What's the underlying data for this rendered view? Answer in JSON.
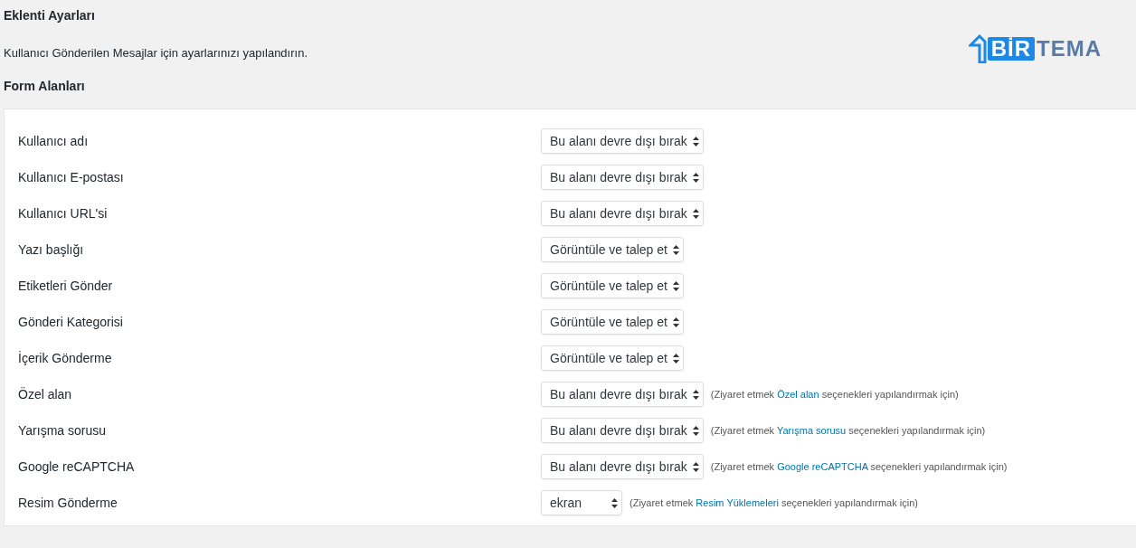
{
  "title": "Eklenti Ayarları",
  "description": "Kullanıcı Gönderilen Mesajlar için ayarlarınızı yapılandırın.",
  "logo": {
    "boxed": "BİR",
    "plain": "TEMA"
  },
  "section_title": "Form Alanları",
  "fields": [
    {
      "label": "Kullanıcı adı",
      "value": "Bu alanı devre dışı bırak"
    },
    {
      "label": "Kullanıcı E-postası",
      "value": "Bu alanı devre dışı bırak"
    },
    {
      "label": "Kullanıcı URL'si",
      "value": "Bu alanı devre dışı bırak"
    },
    {
      "label": "Yazı başlığı",
      "value": "Görüntüle ve talep et"
    },
    {
      "label": "Etiketleri Gönder",
      "value": "Görüntüle ve talep et"
    },
    {
      "label": "Gönderi Kategorisi",
      "value": "Görüntüle ve talep et"
    },
    {
      "label": "İçerik Gönderme",
      "value": "Görüntüle ve talep et"
    },
    {
      "label": "Özel alan",
      "value": "Bu alanı devre dışı bırak",
      "note": {
        "before": "(Ziyaret etmek",
        "link": "Özel alan",
        "after": "seçenekleri yapılandırmak için)"
      }
    },
    {
      "label": "Yarışma sorusu",
      "value": "Bu alanı devre dışı bırak",
      "note": {
        "before": "(Ziyaret etmek",
        "link": "Yarışma sorusu",
        "after": "seçenekleri yapılandırmak için)"
      }
    },
    {
      "label": "Google reCAPTCHA",
      "value": "Bu alanı devre dışı bırak",
      "note": {
        "before": "(Ziyaret etmek",
        "link": "Google reCAPTCHA",
        "after": "seçenekleri yapılandırmak için)"
      }
    },
    {
      "label": "Resim Gönderme",
      "value": "ekran",
      "note": {
        "before": "(Ziyaret etmek",
        "link": "Resim Yüklemeleri",
        "after": "seçenekleri yapılandırmak için)"
      }
    }
  ]
}
